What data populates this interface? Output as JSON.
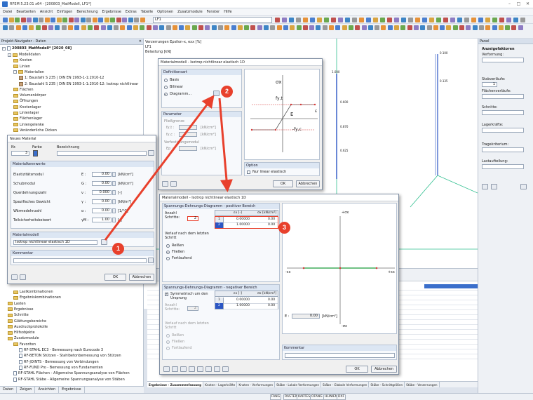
{
  "app": {
    "title": "RFEM 5.23.01 x64 - [200803_MatModell, LF1*]"
  },
  "menu": [
    "Datei",
    "Bearbeiten",
    "Ansicht",
    "Einfügen",
    "Berechnung",
    "Ergebnisse",
    "Extras",
    "Tabelle",
    "Optionen",
    "Zusatzmodule",
    "Fenster",
    "Hilfe"
  ],
  "toolbar": {
    "loadcase": "LF1"
  },
  "navigator": {
    "title": "Projekt-Navigator - Daten",
    "root": "200803_MatModell* [2020_08]",
    "items": [
      {
        "label": "Modelldaten",
        "lvl": 1,
        "kind": "fold",
        "exp": "-"
      },
      {
        "label": "Knoten",
        "lvl": 2,
        "kind": "fold"
      },
      {
        "label": "Linien",
        "lvl": 2,
        "kind": "fold"
      },
      {
        "label": "Materialien",
        "lvl": 2,
        "kind": "fold",
        "exp": "-"
      },
      {
        "label": "1: Baustahl S 235 | DIN EN 1993-1-1:2010-12",
        "lvl": 3,
        "kind": "mat"
      },
      {
        "label": "2: Baustahl S 235 | DIN EN 1993-1-1:2010-12: Isotrop nichtlinear",
        "lvl": 3,
        "kind": "mat"
      },
      {
        "label": "Flächen",
        "lvl": 2,
        "kind": "fold"
      },
      {
        "label": "Volumenkörper",
        "lvl": 2,
        "kind": "fold"
      },
      {
        "label": "Öffnungen",
        "lvl": 2,
        "kind": "fold"
      },
      {
        "label": "Knotenlager",
        "lvl": 2,
        "kind": "fold"
      },
      {
        "label": "Linienlager",
        "lvl": 2,
        "kind": "fold"
      },
      {
        "label": "Flächenlager",
        "lvl": 2,
        "kind": "fold"
      },
      {
        "label": "Liniengelenke",
        "lvl": 2,
        "kind": "fold"
      },
      {
        "label": "Veränderliche Dicken",
        "lvl": 2,
        "kind": "fold"
      }
    ],
    "items_lower": [
      {
        "label": "Lastkombinationen",
        "lvl": 2,
        "kind": "fold"
      },
      {
        "label": "Ergebniskombinationen",
        "lvl": 2,
        "kind": "fold"
      },
      {
        "label": "Lasten",
        "lvl": 1,
        "kind": "fold"
      },
      {
        "label": "Ergebnisse",
        "lvl": 1,
        "kind": "fold"
      },
      {
        "label": "Schnitte",
        "lvl": 1,
        "kind": "fold"
      },
      {
        "label": "Glättungsbereiche",
        "lvl": 1,
        "kind": "fold"
      },
      {
        "label": "Ausdruckprotokolle",
        "lvl": 1,
        "kind": "fold"
      },
      {
        "label": "Hilfsobjekte",
        "lvl": 1,
        "kind": "fold"
      },
      {
        "label": "Zusatzmodule",
        "lvl": 1,
        "kind": "fold"
      },
      {
        "label": "Favoriten",
        "lvl": 2,
        "kind": "fold"
      },
      {
        "label": "RF-STAHL EC3 - Bemessung nach Eurocode 3",
        "lvl": 3,
        "kind": "doc"
      },
      {
        "label": "RF-BETON Stützen - Stahlbetonbemessung von Stützen",
        "lvl": 3,
        "kind": "doc"
      },
      {
        "label": "RF-JOINTS - Bemessung von Verbindungen",
        "lvl": 3,
        "kind": "doc"
      },
      {
        "label": "RF-FUND Pro - Bemessung von Fundamenten",
        "lvl": 3,
        "kind": "doc"
      },
      {
        "label": "RF-STAHL Flächen - Allgemeine Spannungsanalyse von Flächen",
        "lvl": 2,
        "kind": "doc"
      },
      {
        "label": "RF-STAHL Stäbe - Allgemeine Spannungsanalyse von Stäben",
        "lvl": 2,
        "kind": "doc"
      }
    ],
    "tabs": [
      "Daten",
      "Zeigen",
      "Ansichten",
      "Ergebnisse"
    ]
  },
  "canvas": {
    "header": [
      "Verzerrungen Epsilon-x, exx [%]",
      "LF1",
      "Belastung [kN]"
    ],
    "axis_labels": [
      "1.000",
      "0.100",
      "0.600",
      "0.870",
      "0.625",
      "0.135"
    ],
    "top_label": "0.100"
  },
  "right_panel": {
    "title": "Panel",
    "sections": [
      "Anzeigefaktoren",
      "Verformung:",
      "Stabverläufe:",
      "Flächenverläufe:",
      "Schnitte:",
      "Lagerkräfte:",
      "Tragekriterium:",
      "Lastaufteilung:"
    ],
    "stab_value": "1"
  },
  "bottom_tabs": [
    "Ergebnisse - Zusammenfassung",
    "Knoten - Lagerkräfte",
    "Knoten - Verformungen",
    "Stäbe - Lokale Verformungen",
    "Stäbe - Globale Verformungen",
    "Stäbe - Schnittgrößen",
    "Stäbe - Verzerrungen"
  ],
  "status": [
    "FANG",
    "RASTER",
    "KARTES",
    "OFANG",
    "HLINIEN",
    "DXF"
  ],
  "neues_material": {
    "title": "Neues Material",
    "nr_label": "Nr.",
    "nr": "3",
    "farbe_label": "Farbe",
    "bez_label": "Bezeichnung",
    "section_kennwerte": "Materialkennwerte",
    "rows": [
      {
        "label": "Elastizitätsmodul",
        "sym": "E :",
        "val": "0.00",
        "unit": "[kN/cm²]"
      },
      {
        "label": "Schubmodul",
        "sym": "G :",
        "val": "0.00",
        "unit": "[kN/cm²]"
      },
      {
        "label": "Querdehnungszahl",
        "sym": "ν :",
        "val": "0.000",
        "unit": "[-]"
      },
      {
        "label": "Spezifisches Gewicht",
        "sym": "γ :",
        "val": "0.00",
        "unit": "[kN/m³]"
      },
      {
        "label": "Wärmedehnzahl",
        "sym": "α :",
        "val": "0.00",
        "unit": "[1/°C]"
      },
      {
        "label": "Teilsicherheitsbeiwert",
        "sym": "γM :",
        "val": "1.00",
        "unit": "[-]"
      }
    ],
    "section_modell": "Materialmodell",
    "modell_value": "Isotrop nichtlinear elastisch 1D",
    "section_kommentar": "Kommentar",
    "ok": "OK",
    "cancel": "Abbrechen"
  },
  "materialmodell_a": {
    "title": "Materialmodell - Isotrop nichtlinear elastisch 1D",
    "section_def": "Definitionsart",
    "options": [
      "Basis",
      "Bilinear",
      "Diagramm..."
    ],
    "section_params": "Parameter",
    "fliess_label": "Fließgrenze",
    "param_rows": [
      {
        "label": "fy,t :",
        "unit": "[kN/cm²]"
      },
      {
        "label": "fy,c :",
        "unit": "[kN/cm²]"
      }
    ],
    "verfestigung_label": "Verfestigungsmodul",
    "ep_label": "Ep :",
    "ep_unit": "[kN/cm²]",
    "section_option": "Option",
    "option_check": "Nur linear elastisch",
    "ok": "OK",
    "cancel": "Abbrechen",
    "diag": {
      "sigma": "σx",
      "fyt": "fy,t",
      "fyc": "-fy,c",
      "E": "E",
      "eps": "ε"
    }
  },
  "materialmodell_b": {
    "title": "Materialmodell - Isotrop nichtlinear elastisch 1D",
    "section_pos": "Spannungs-Dehnungs-Diagramm - positiver Bereich",
    "anzahl_label": "Anzahl Schritte:",
    "anzahl_val": "2",
    "col_eps": "εx [-]",
    "col_sig": "σx [kN/cm²]",
    "pos_rows": [
      {
        "nr": "1",
        "eps": "0.00000",
        "sig": "0.00"
      },
      {
        "nr": "2",
        "eps": "1.00000",
        "sig": "0.00"
      }
    ],
    "verlauf_label": "Verlauf nach dem letzten Schritt",
    "verlauf_opts": [
      "Reißen",
      "Fließen",
      "Fortlaufend"
    ],
    "section_neg": "Spannungs-Dehnungs-Diagramm - negativer Bereich",
    "sym_label": "Symmetrisch um den Ursprung",
    "anzahl_neg_val": "2",
    "neg_rows": [
      {
        "nr": "1",
        "eps": "0.00000",
        "sig": "0.00"
      },
      {
        "nr": "2",
        "eps": "1.00000",
        "sig": "0.00"
      }
    ],
    "plot": {
      "sx": "+σx",
      "sx_neg": "-σx",
      "ex": "+εx",
      "ex_neg": "-εx"
    },
    "e_label": "E :",
    "e_val": "0.00",
    "e_unit": "[kN/cm²]",
    "section_kommentar": "Kommentar",
    "ok": "OK",
    "cancel": "Abbrechen"
  },
  "callouts": [
    "1",
    "2",
    "3"
  ],
  "colors": {
    "callout": "#e8402c",
    "accent": "#2b56c4",
    "node": "#d63a3a"
  }
}
